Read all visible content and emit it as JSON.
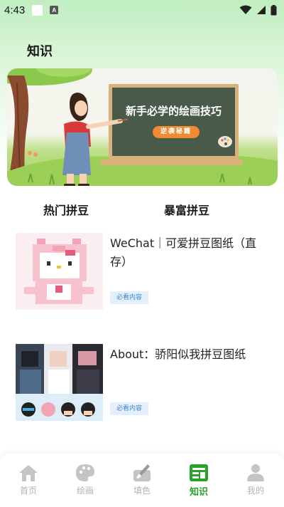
{
  "status_bar": {
    "time": "4:43",
    "notif_a": "A"
  },
  "page": {
    "title": "知识"
  },
  "banner": {
    "board_title": "新手必学的绘画技巧",
    "pill_text": "逆袭秘籍"
  },
  "tabs": [
    {
      "label": "热门拼豆"
    },
    {
      "label": "暴富拼豆"
    }
  ],
  "items": [
    {
      "title": "WeChat｜可爱拼豆图纸（直存）",
      "badge": "必看内容"
    },
    {
      "title": "About：骄阳似我拼豆图纸",
      "badge": "必看内容"
    }
  ],
  "bottom_nav": [
    {
      "label": "首页",
      "icon": "home-icon"
    },
    {
      "label": "绘画",
      "icon": "palette-icon"
    },
    {
      "label": "填色",
      "icon": "paint-brush-icon"
    },
    {
      "label": "知识",
      "icon": "knowledge-icon",
      "active": true
    },
    {
      "label": "我的",
      "icon": "person-icon"
    }
  ],
  "colors": {
    "active_green": "#2aa12a",
    "inactive_gray": "#b3b3b3",
    "badge_blue": "#3a87cc",
    "badge_bg": "#e3f0fb"
  }
}
